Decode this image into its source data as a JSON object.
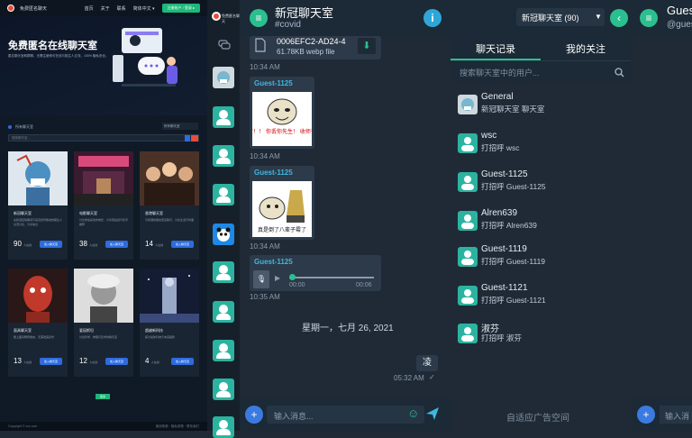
{
  "landing": {
    "brand": "免费匿名聊天",
    "nav": [
      "首页",
      "关于",
      "联系",
      "简体中文 ▾"
    ],
    "nav_button": "注册账户 / 登录 ▸",
    "hero_title": "免费匿名在线聊天室",
    "hero_desc": "匿名聊天室和群聊，无需注册即可在线与陌生人交流，100% 隐私安全。",
    "section_label": "所有聊天室",
    "filter_label": "所有聊天室",
    "search_placeholder": "搜索聊天室...",
    "cards": [
      {
        "title": "新冠聊天室",
        "desc": "在新冠疫情期间与来自世界各地的陌生人交流讨论、分享信息",
        "count": "90",
        "unit": "人在线",
        "btn": "加入聊天室"
      },
      {
        "title": "电影聊天室",
        "desc": "讨论你最喜欢的电影，分享观后感与影评推荐",
        "count": "38",
        "unit": "人在线",
        "btn": "加入聊天室"
      },
      {
        "title": "香港聊天室",
        "desc": "与香港的朋友匿名聊天，讨论生活与时事",
        "count": "14",
        "unit": "人在线",
        "btn": "加入聊天室"
      },
      {
        "title": "面具聊天室",
        "desc": "戴上面具畅所欲言，无需透露身份",
        "count": "13",
        "unit": "人在线",
        "btn": "加入聊天室"
      },
      {
        "title": "爱因斯坦",
        "desc": "讨论科学、物理与哲学的聊天室",
        "count": "12",
        "unit": "人在线",
        "btn": "加入聊天室"
      },
      {
        "title": "超越新科技",
        "desc": "探讨最新科技与未来趋势",
        "count": "4",
        "unit": "人在线",
        "btn": "加入聊天室"
      }
    ],
    "more_button": "更多",
    "footer_left": "Copyright © xxx.com",
    "footer_right": "使用条款 · 隐私政策 · 联系我们"
  },
  "chat": {
    "title": "新冠聊天室",
    "subtitle": "#covid",
    "file_name": "0006EFC2-AD24-4",
    "file_meta": "61.78KB webp file",
    "time1": "10:34 AM",
    "msg2_sender": "Guest-1125",
    "sticker1_caption": "要冲级了！！ 你丢你先生！ 收师哥事前！",
    "time2": "10:34 AM",
    "msg3_sender": "Guest-1125",
    "sticker2_caption": "真是倒了八辈子霉了",
    "time3": "10:34 AM",
    "msg4_sender": "Guest-1125",
    "audio_start": "00:00",
    "audio_end": "00:06",
    "time4": "10:35 AM",
    "date_sep": "星期一，七月 26, 2021",
    "own_msg": "凌",
    "own_time": "05:32 AM",
    "input_placeholder": "输入消息..."
  },
  "rooms": {
    "brand": "免费匿名聊天",
    "selector": "新冠聊天室 (90)",
    "tabs": [
      "聊天记录",
      "我的关注"
    ],
    "search_placeholder": "搜索聊天室中的用户...",
    "list": [
      {
        "name": "General",
        "desc": "新冠聊天室 聊天室"
      },
      {
        "name": "wsc",
        "desc": "打招呼 wsc"
      },
      {
        "name": "Guest-1125",
        "desc": "打招呼 Guest-1125"
      },
      {
        "name": "Alren639",
        "desc": "打招呼 Alren639"
      },
      {
        "name": "Guest-1119",
        "desc": "打招呼 Guest-1119"
      },
      {
        "name": "Guest-1121",
        "desc": "打招呼 Guest-1121"
      },
      {
        "name": "淑芬",
        "desc": "打招呼 淑芬"
      }
    ],
    "ad_text": "自适应广告空间"
  },
  "partial": {
    "title": "Gues",
    "sub": "@gues",
    "input_placeholder": "输入消"
  },
  "colors": {
    "accent": "#2bbf8f",
    "sender": "#3fb8e0",
    "info": "#2fa6d8",
    "send": "#2d6cdf"
  }
}
